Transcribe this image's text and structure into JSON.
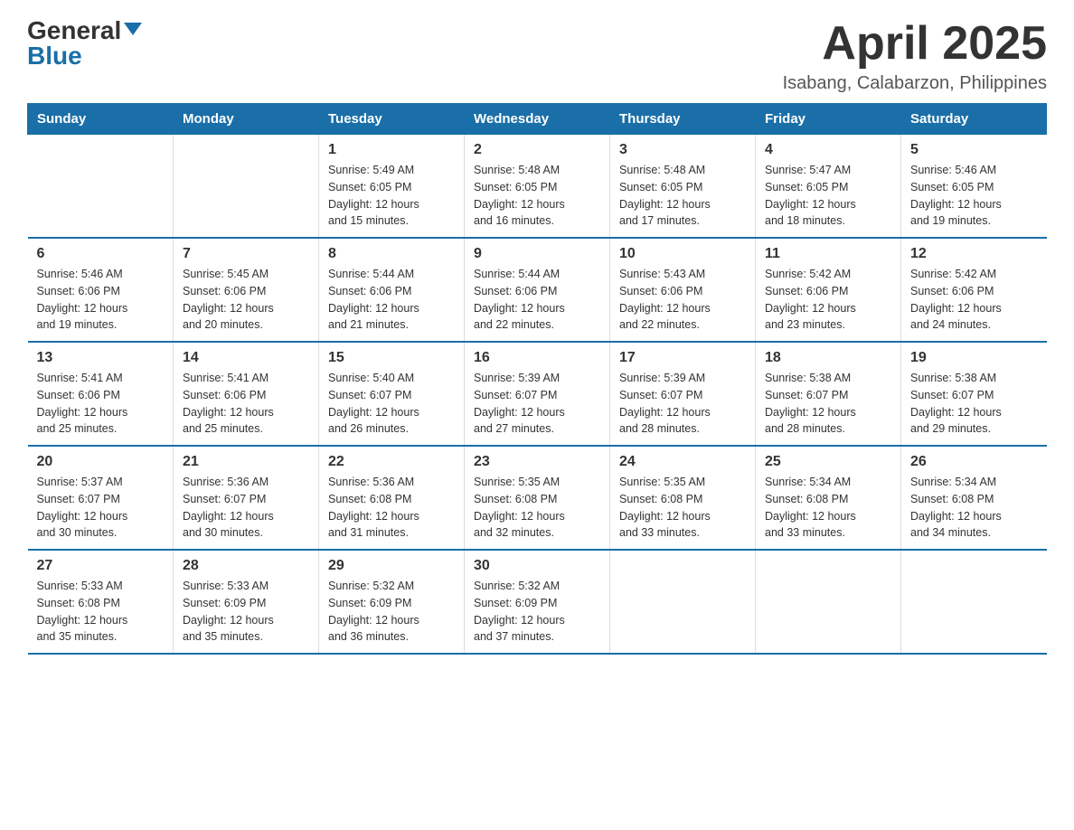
{
  "logo": {
    "general": "General",
    "blue": "Blue"
  },
  "title": "April 2025",
  "subtitle": "Isabang, Calabarzon, Philippines",
  "headers": [
    "Sunday",
    "Monday",
    "Tuesday",
    "Wednesday",
    "Thursday",
    "Friday",
    "Saturday"
  ],
  "weeks": [
    [
      {
        "day": "",
        "info": ""
      },
      {
        "day": "",
        "info": ""
      },
      {
        "day": "1",
        "info": "Sunrise: 5:49 AM\nSunset: 6:05 PM\nDaylight: 12 hours\nand 15 minutes."
      },
      {
        "day": "2",
        "info": "Sunrise: 5:48 AM\nSunset: 6:05 PM\nDaylight: 12 hours\nand 16 minutes."
      },
      {
        "day": "3",
        "info": "Sunrise: 5:48 AM\nSunset: 6:05 PM\nDaylight: 12 hours\nand 17 minutes."
      },
      {
        "day": "4",
        "info": "Sunrise: 5:47 AM\nSunset: 6:05 PM\nDaylight: 12 hours\nand 18 minutes."
      },
      {
        "day": "5",
        "info": "Sunrise: 5:46 AM\nSunset: 6:05 PM\nDaylight: 12 hours\nand 19 minutes."
      }
    ],
    [
      {
        "day": "6",
        "info": "Sunrise: 5:46 AM\nSunset: 6:06 PM\nDaylight: 12 hours\nand 19 minutes."
      },
      {
        "day": "7",
        "info": "Sunrise: 5:45 AM\nSunset: 6:06 PM\nDaylight: 12 hours\nand 20 minutes."
      },
      {
        "day": "8",
        "info": "Sunrise: 5:44 AM\nSunset: 6:06 PM\nDaylight: 12 hours\nand 21 minutes."
      },
      {
        "day": "9",
        "info": "Sunrise: 5:44 AM\nSunset: 6:06 PM\nDaylight: 12 hours\nand 22 minutes."
      },
      {
        "day": "10",
        "info": "Sunrise: 5:43 AM\nSunset: 6:06 PM\nDaylight: 12 hours\nand 22 minutes."
      },
      {
        "day": "11",
        "info": "Sunrise: 5:42 AM\nSunset: 6:06 PM\nDaylight: 12 hours\nand 23 minutes."
      },
      {
        "day": "12",
        "info": "Sunrise: 5:42 AM\nSunset: 6:06 PM\nDaylight: 12 hours\nand 24 minutes."
      }
    ],
    [
      {
        "day": "13",
        "info": "Sunrise: 5:41 AM\nSunset: 6:06 PM\nDaylight: 12 hours\nand 25 minutes."
      },
      {
        "day": "14",
        "info": "Sunrise: 5:41 AM\nSunset: 6:06 PM\nDaylight: 12 hours\nand 25 minutes."
      },
      {
        "day": "15",
        "info": "Sunrise: 5:40 AM\nSunset: 6:07 PM\nDaylight: 12 hours\nand 26 minutes."
      },
      {
        "day": "16",
        "info": "Sunrise: 5:39 AM\nSunset: 6:07 PM\nDaylight: 12 hours\nand 27 minutes."
      },
      {
        "day": "17",
        "info": "Sunrise: 5:39 AM\nSunset: 6:07 PM\nDaylight: 12 hours\nand 28 minutes."
      },
      {
        "day": "18",
        "info": "Sunrise: 5:38 AM\nSunset: 6:07 PM\nDaylight: 12 hours\nand 28 minutes."
      },
      {
        "day": "19",
        "info": "Sunrise: 5:38 AM\nSunset: 6:07 PM\nDaylight: 12 hours\nand 29 minutes."
      }
    ],
    [
      {
        "day": "20",
        "info": "Sunrise: 5:37 AM\nSunset: 6:07 PM\nDaylight: 12 hours\nand 30 minutes."
      },
      {
        "day": "21",
        "info": "Sunrise: 5:36 AM\nSunset: 6:07 PM\nDaylight: 12 hours\nand 30 minutes."
      },
      {
        "day": "22",
        "info": "Sunrise: 5:36 AM\nSunset: 6:08 PM\nDaylight: 12 hours\nand 31 minutes."
      },
      {
        "day": "23",
        "info": "Sunrise: 5:35 AM\nSunset: 6:08 PM\nDaylight: 12 hours\nand 32 minutes."
      },
      {
        "day": "24",
        "info": "Sunrise: 5:35 AM\nSunset: 6:08 PM\nDaylight: 12 hours\nand 33 minutes."
      },
      {
        "day": "25",
        "info": "Sunrise: 5:34 AM\nSunset: 6:08 PM\nDaylight: 12 hours\nand 33 minutes."
      },
      {
        "day": "26",
        "info": "Sunrise: 5:34 AM\nSunset: 6:08 PM\nDaylight: 12 hours\nand 34 minutes."
      }
    ],
    [
      {
        "day": "27",
        "info": "Sunrise: 5:33 AM\nSunset: 6:08 PM\nDaylight: 12 hours\nand 35 minutes."
      },
      {
        "day": "28",
        "info": "Sunrise: 5:33 AM\nSunset: 6:09 PM\nDaylight: 12 hours\nand 35 minutes."
      },
      {
        "day": "29",
        "info": "Sunrise: 5:32 AM\nSunset: 6:09 PM\nDaylight: 12 hours\nand 36 minutes."
      },
      {
        "day": "30",
        "info": "Sunrise: 5:32 AM\nSunset: 6:09 PM\nDaylight: 12 hours\nand 37 minutes."
      },
      {
        "day": "",
        "info": ""
      },
      {
        "day": "",
        "info": ""
      },
      {
        "day": "",
        "info": ""
      }
    ]
  ]
}
